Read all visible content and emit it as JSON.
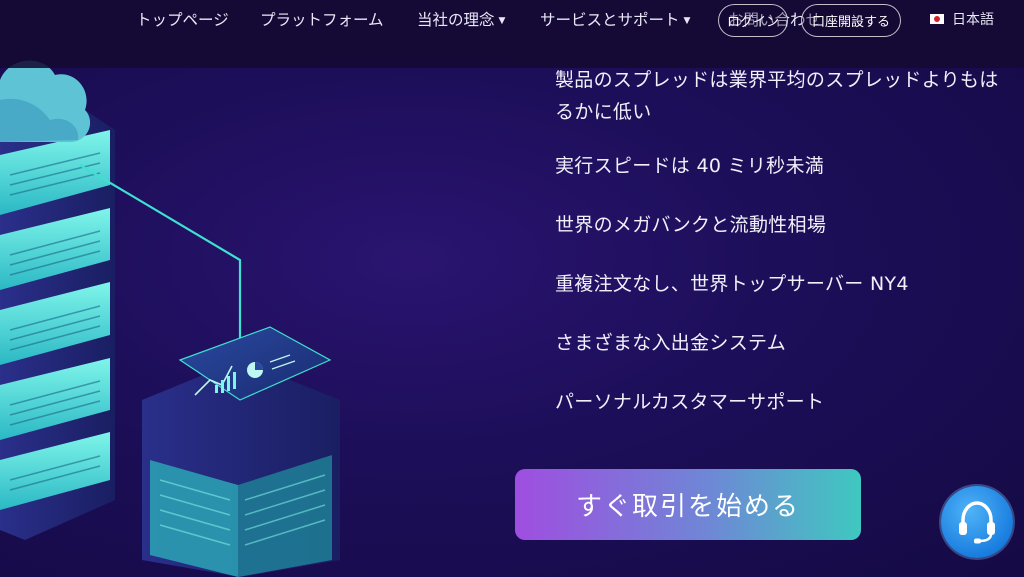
{
  "nav": {
    "items": [
      {
        "label": "トップページ",
        "has_caret": false
      },
      {
        "label": "プラットフォーム",
        "has_caret": false
      },
      {
        "label": "当社の理念",
        "has_caret": true
      },
      {
        "label": "サービスとサポート",
        "has_caret": true
      },
      {
        "label": "お問い合わせ",
        "has_caret": false
      }
    ],
    "login_label": "ログイン",
    "open_account_label": "口座開設する",
    "language": "日本語"
  },
  "features": [
    "製品のスプレッドは業界平均のスプレッドよりもはるかに低い",
    "実行スピードは 40 ミリ秒未満",
    "世界のメガバンクと流動性相場",
    "重複注文なし、世界トップサーバー NY4",
    "さまざまな入出金システム",
    "パーソナルカスタマーサポート"
  ],
  "cta": {
    "label": "すぐ取引を始める"
  },
  "colors": {
    "background": "#1c0e58",
    "cta_start": "#9f4ee0",
    "cta_end": "#3fc8c0",
    "accent_teal": "#3ee0d0"
  },
  "icons": {
    "support": "headset-icon",
    "language": "japan-flag-icon"
  }
}
